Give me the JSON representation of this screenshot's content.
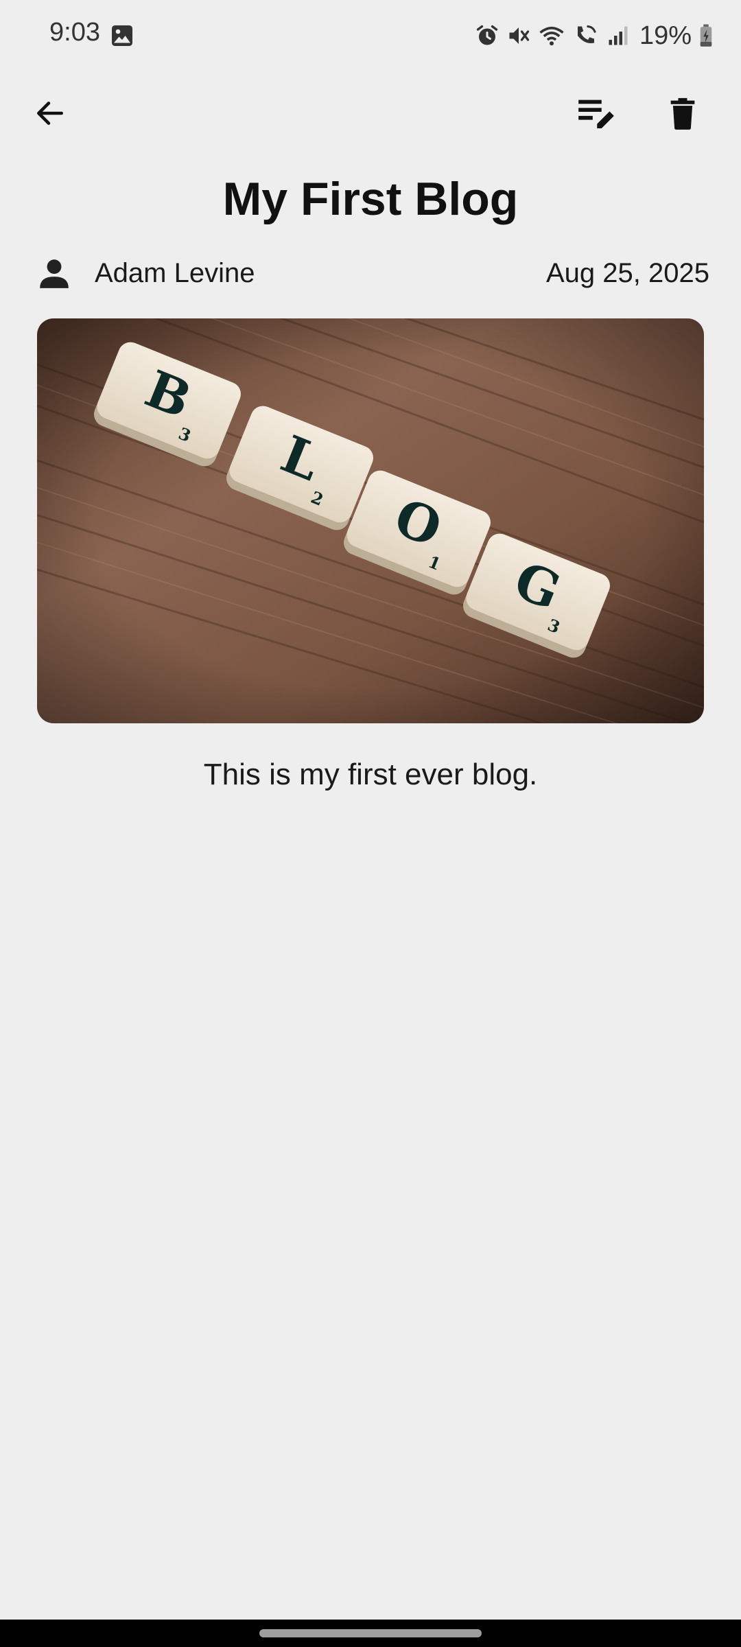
{
  "status_bar": {
    "time": "9:03",
    "battery": "19%",
    "icons": [
      "gallery-icon",
      "alarm-icon",
      "mute-icon",
      "wifi-icon",
      "wifi-calling-icon",
      "signal-icon",
      "battery-charging-icon"
    ]
  },
  "app_bar": {
    "icons": [
      "back-arrow-icon",
      "edit-note-icon",
      "trash-icon"
    ]
  },
  "post": {
    "title": "My First Blog",
    "author": "Adam Levine",
    "date": "Aug 25, 2025",
    "image": {
      "tiles": [
        {
          "letter": "B",
          "score": "3"
        },
        {
          "letter": "L",
          "score": "2"
        },
        {
          "letter": "O",
          "score": "1"
        },
        {
          "letter": "G",
          "score": "3"
        }
      ]
    },
    "body": "This is my first ever blog."
  },
  "colors": {
    "background": "#eeeeee",
    "text": "#111111",
    "wood": "#7a5440",
    "tile": "#ede3d2"
  }
}
